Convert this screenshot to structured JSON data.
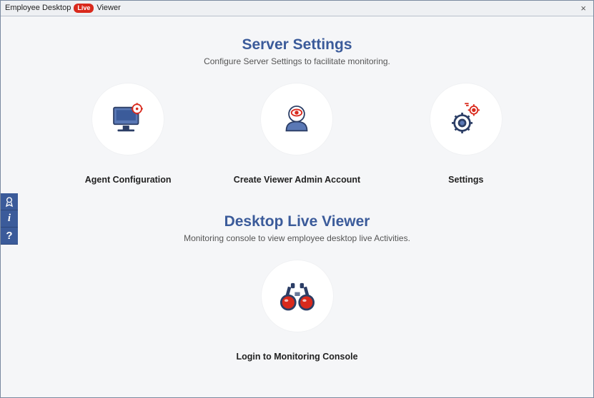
{
  "titlebar": {
    "prefix": "Employee Desktop",
    "badge": "Live",
    "suffix": "Viewer",
    "close": "×"
  },
  "section1": {
    "title": "Server Settings",
    "subtitle": "Configure Server Settings to facilitate monitoring.",
    "tiles": {
      "agent": "Agent Configuration",
      "admin": "Create Viewer Admin Account",
      "settings": "Settings"
    }
  },
  "section2": {
    "title": "Desktop Live Viewer",
    "subtitle": "Monitoring console to view employee desktop live Activities.",
    "tiles": {
      "login": "Login to Monitoring Console"
    }
  },
  "sidebar": {
    "award_icon": "award-icon",
    "info_label": "i",
    "help_label": "?"
  }
}
